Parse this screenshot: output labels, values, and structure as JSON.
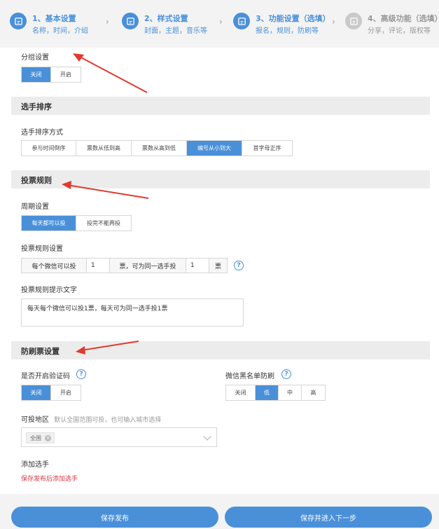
{
  "steps": [
    {
      "title": "1、基本设置",
      "sub": "名称，时间，介绍",
      "active": true
    },
    {
      "title": "2、样式设置",
      "sub": "封面，主题，音乐等",
      "active": true
    },
    {
      "title": "3、功能设置（选填）",
      "sub": "报名，规则，防刷等",
      "active": true
    },
    {
      "title": "4、高级功能（选填）",
      "sub": "分享，评论，版权等",
      "active": false
    }
  ],
  "group": {
    "label": "分组设置",
    "options": [
      "关闭",
      "开启"
    ],
    "selected": "关闭"
  },
  "player_sort": {
    "section_title": "选手排序",
    "label": "选手排序方式",
    "options": [
      "参与时间倒序",
      "票数从低到高",
      "票数从高到低",
      "编号从小到大",
      "首字母正序"
    ],
    "selected": "编号从小到大"
  },
  "vote_rules": {
    "section_title": "投票规则",
    "period_label": "周期设置",
    "period_options": [
      "每天都可以投",
      "投完不能再投"
    ],
    "period_selected": "每天都可以投",
    "rule_label": "投票规则设置",
    "rule_prefix": "每个微信可以投",
    "rule_value1": "1",
    "rule_middle": "票，可为同一选手投",
    "rule_value2": "1",
    "rule_suffix": "票",
    "help_mark": "?",
    "prompt_label": "投票规则提示文字",
    "prompt_text": "每天每个微信可以投1票，每天可为同一选手投1票"
  },
  "anti_fraud": {
    "section_title": "防刷票设置",
    "captcha_label": "是否开启验证码",
    "captcha_options": [
      "关闭",
      "开启"
    ],
    "captcha_selected": "关闭",
    "blacklist_label": "微信黑名单防刷",
    "blacklist_options": [
      "关闭",
      "低",
      "中",
      "高"
    ],
    "blacklist_selected": "低",
    "region_label": "可投地区",
    "region_hint": "默认全国范围可投，也可输入城市选择",
    "region_tag": "全国",
    "add_player_label": "添加选手",
    "add_player_hint": "保存发布后添加选手"
  },
  "buttons": {
    "save_publish": "保存发布",
    "save_next": "保存并进入下一步"
  },
  "colors": {
    "accent": "#4a90d9",
    "annotation_arrow": "#e03a2f",
    "hint_red": "#d9363e"
  }
}
